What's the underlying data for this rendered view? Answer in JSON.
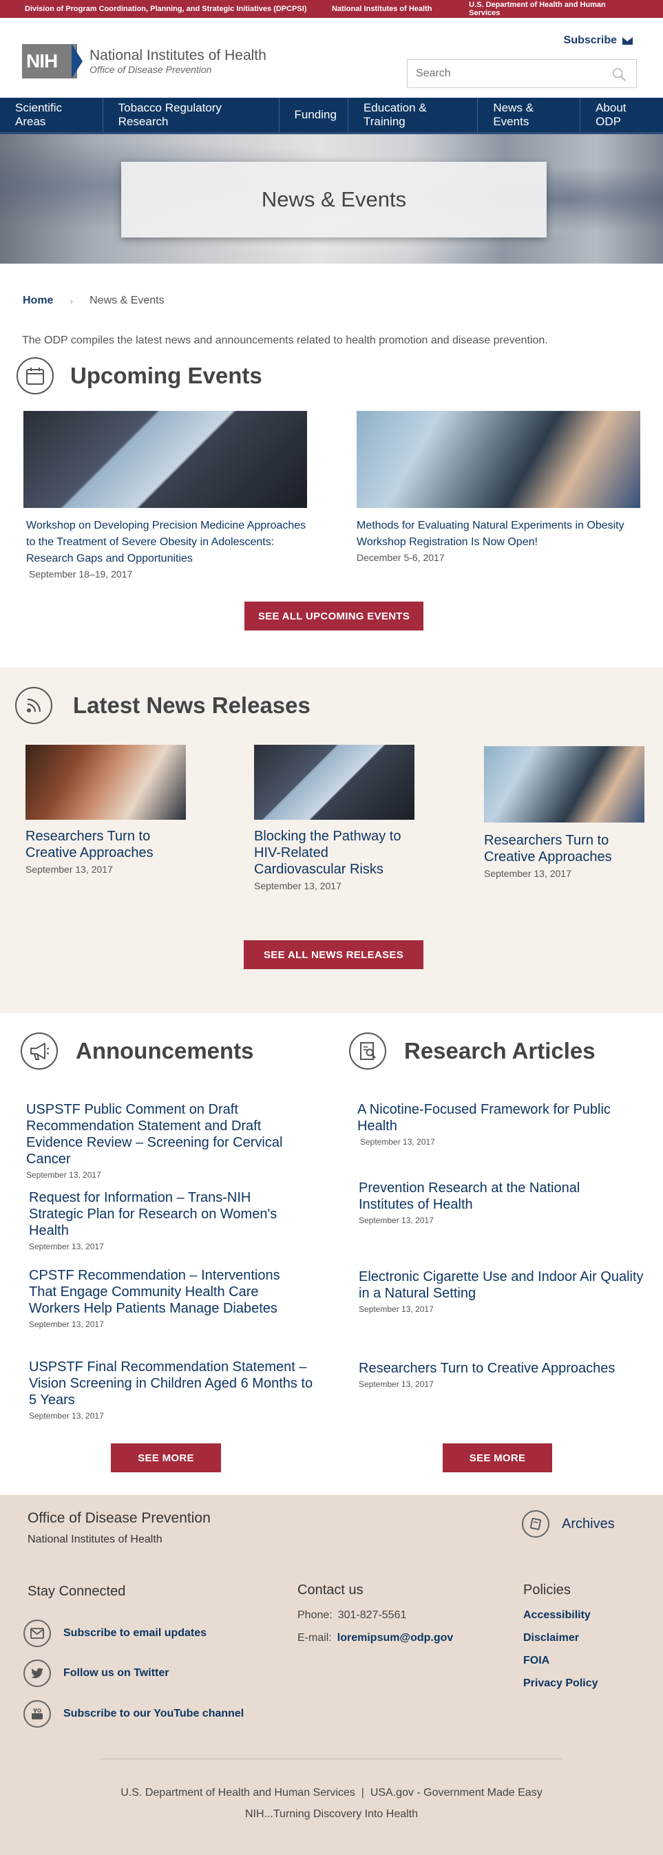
{
  "topbar": {
    "link1": "Division of Program Coordination, Planning, and Strategic Initiatives (DPCPSI)",
    "link2": "National Institutes of Health",
    "link3": "U.S. Department of Health and Human Services"
  },
  "header": {
    "logo_abbr": "NIH",
    "logo_title": "National Institutes of Health",
    "logo_subtitle": "Office of Disease Prevention",
    "subscribe_label": "Subscribe",
    "search_placeholder": "Search"
  },
  "nav": {
    "items": [
      "Scientific Areas",
      "Tobacco Regulatory Research",
      "Funding",
      "Education & Training",
      "News & Events",
      "About ODP"
    ]
  },
  "hero": {
    "title": "News & Events"
  },
  "breadcrumb": {
    "home": "Home",
    "separator": "›",
    "current": "News & Events"
  },
  "intro": "The ODP compiles the latest news and announcements related to health promotion and disease prevention.",
  "events": {
    "title": "Upcoming Events",
    "items": [
      {
        "title": "Workshop on Developing Precision Medicine Approaches to the Treatment of Severe Obesity in Adolescents: Research Gaps and Opportunities",
        "date": "September 18–19, 2017"
      },
      {
        "title": "Methods for Evaluating Natural Experiments in Obesity Workshop Registration Is Now Open!",
        "date": "December 5-6, 2017"
      }
    ],
    "button": "SEE ALL UPCOMING EVENTS"
  },
  "news": {
    "title": "Latest News Releases",
    "items": [
      {
        "title": "Researchers Turn to Creative Approaches",
        "date": "September 13, 2017"
      },
      {
        "title": "Blocking the Pathway to HIV-Related Cardiovascular Risks",
        "date": "September 13, 2017"
      },
      {
        "title": "Researchers Turn to Creative Approaches",
        "date": "September 13, 2017"
      }
    ],
    "button": "SEE ALL NEWS RELEASES"
  },
  "announcements": {
    "title": "Announcements",
    "items": [
      {
        "title": "USPSTF Public Comment on Draft Recommendation Statement and Draft Evidence Review – Screening for Cervical Cancer",
        "date": "September 13, 2017"
      },
      {
        "title": "Request for Information – Trans-NIH Strategic Plan for Research on Women's Health",
        "date": "September 13, 2017"
      },
      {
        "title": "CPSTF Recommendation – Interventions That Engage Community Health Care Workers Help Patients Manage Diabetes",
        "date": "September 13, 2017"
      },
      {
        "title": "USPSTF Final Recommendation Statement – Vision Screening in Children Aged 6 Months to 5 Years",
        "date": "September 13, 2017"
      }
    ],
    "button": "SEE MORE"
  },
  "research": {
    "title": "Research Articles",
    "items": [
      {
        "title": "A Nicotine-Focused Framework for Public Health",
        "date": "September 13, 2017"
      },
      {
        "title": "Prevention Research at the National Institutes of Health",
        "date": "September 13, 2017"
      },
      {
        "title": "Electronic Cigarette Use and Indoor Air Quality in a Natural Setting",
        "date": "September 13, 2017"
      },
      {
        "title": "Researchers Turn to Creative Approaches",
        "date": "September 13, 2017"
      }
    ],
    "button": "SEE MORE"
  },
  "footer": {
    "org": "Office of Disease Prevention",
    "parent": "National Institutes of Health",
    "archives": "Archives",
    "stay_connected": "Stay Connected",
    "social": [
      "Subscribe to email updates",
      "Follow us on Twitter",
      "Subscribe to our YouTube channel"
    ],
    "contact_title": "Contact us",
    "phone_label": "Phone:",
    "phone": "301-827-5561",
    "email_label": "E-mail:",
    "email": "loremipsum@odp.gov",
    "policies_title": "Policies",
    "policies": [
      "Accessibility",
      "Disclaimer",
      "FOIA",
      "Privacy Policy"
    ],
    "bottom_line1": "U.S. Department of Health and Human Services  |  USA.gov - Government Made Easy",
    "bottom_line2": "NIH...Turning Discovery Into Health"
  }
}
